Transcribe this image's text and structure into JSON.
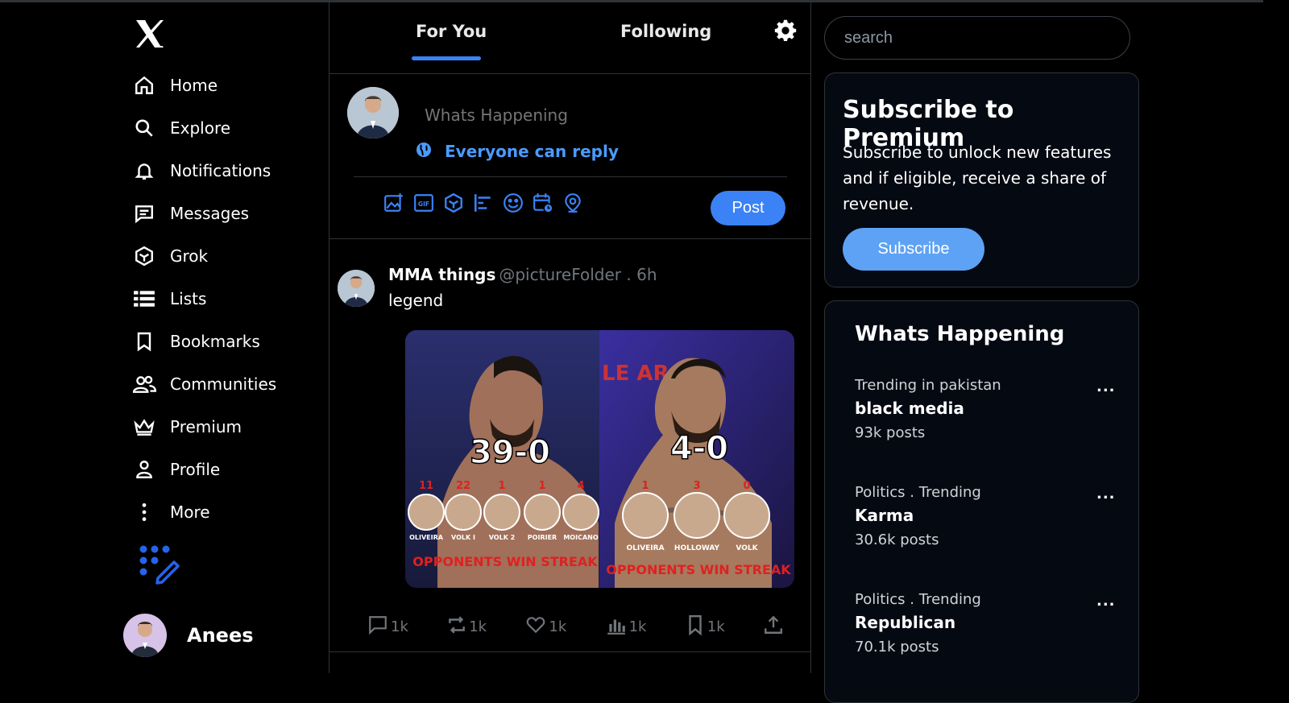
{
  "nav": {
    "items": [
      {
        "label": "Home",
        "icon": "home-icon"
      },
      {
        "label": "Explore",
        "icon": "search-icon"
      },
      {
        "label": "Notifications",
        "icon": "bell-icon"
      },
      {
        "label": "Messages",
        "icon": "message-icon"
      },
      {
        "label": "Grok",
        "icon": "grok-icon"
      },
      {
        "label": "Lists",
        "icon": "list-icon"
      },
      {
        "label": "Bookmarks",
        "icon": "bookmark-icon"
      },
      {
        "label": "Communities",
        "icon": "communities-icon"
      },
      {
        "label": "Premium",
        "icon": "crown-icon"
      },
      {
        "label": "Profile",
        "icon": "person-icon"
      },
      {
        "label": "More",
        "icon": "more-vertical-icon"
      }
    ],
    "user_name": "Anees"
  },
  "tabs": {
    "for_you": "For You",
    "following": "Following"
  },
  "composer": {
    "placeholder": "Whats Happening",
    "reply_setting": "Everyone can reply",
    "post_label": "Post"
  },
  "tweet": {
    "name": "MMA things",
    "handle": "@pictureFolder . 6h",
    "text": "legend",
    "media": {
      "left": {
        "record": "39-0",
        "streak": [
          "11",
          "22",
          "1",
          "1",
          "4"
        ],
        "names": [
          "OLIVEIRA",
          "VOLK I",
          "VOLK 2",
          "POIRIER",
          "MOICANO"
        ],
        "caption": "OPPONENTS WIN STREAK",
        "banner": ""
      },
      "right": {
        "record": "4-0",
        "streak": [
          "1",
          "3",
          "0"
        ],
        "names": [
          "OLIVEIRA",
          "HOLLOWAY",
          "VOLK"
        ],
        "caption": "OPPONENTS WIN STREAK",
        "banner": "LE AR"
      }
    },
    "actions": {
      "reply": "1k",
      "retweet": "1k",
      "like": "1k",
      "views": "1k",
      "bookmark": "1k"
    }
  },
  "search": {
    "placeholder": "search"
  },
  "premium": {
    "title": "Subscribe to Premium",
    "text": "Subscribe to unlock new features and if eligible, receive a share of revenue.",
    "button": "Subscribe"
  },
  "trends": {
    "title": "Whats Happening",
    "items": [
      {
        "category": "Trending in pakistan",
        "topic": "black media",
        "count": "93k posts",
        "more": "..."
      },
      {
        "category": "Politics . Trending",
        "topic": "Karma",
        "count": "30.6k posts",
        "more": "..."
      },
      {
        "category": "Politics . Trending",
        "topic": "Republican",
        "count": "70.1k posts",
        "more": "..."
      }
    ]
  },
  "colors": {
    "accent": "#3b82f6",
    "background": "#000000",
    "card": "#050912"
  }
}
